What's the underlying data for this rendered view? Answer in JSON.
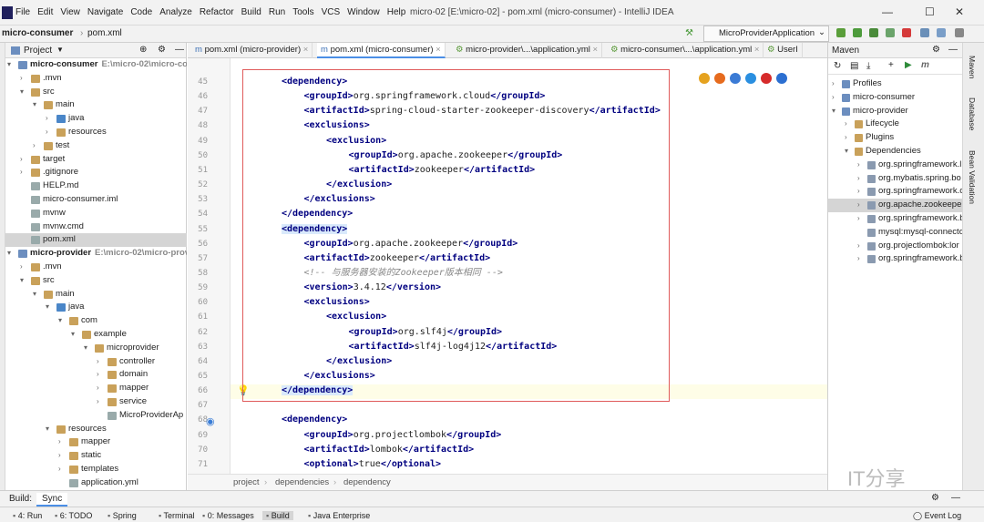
{
  "menu": [
    "File",
    "Edit",
    "View",
    "Navigate",
    "Code",
    "Analyze",
    "Refactor",
    "Build",
    "Run",
    "Tools",
    "VCS",
    "Window",
    "Help"
  ],
  "window_title": "micro-02 [E:\\micro-02] - pom.xml (micro-consumer) - IntelliJ IDEA",
  "breadcrumb_top": [
    "micro-consumer",
    "pom.xml"
  ],
  "run_config": "MicroProviderApplication",
  "project_panel": {
    "title": "Project"
  },
  "tree": [
    {
      "label": "micro-consumer",
      "path": "E:\\micro-02\\micro-cons",
      "level": 0,
      "bold": true
    },
    {
      "label": ".mvn",
      "level": 1
    },
    {
      "label": "src",
      "level": 1
    },
    {
      "label": "main",
      "level": 2
    },
    {
      "label": "java",
      "level": 3
    },
    {
      "label": "resources",
      "level": 3
    },
    {
      "label": "test",
      "level": 2
    },
    {
      "label": "target",
      "level": 1
    },
    {
      "label": ".gitignore",
      "level": 1
    },
    {
      "label": "HELP.md",
      "level": 1
    },
    {
      "label": "micro-consumer.iml",
      "level": 1
    },
    {
      "label": "mvnw",
      "level": 1
    },
    {
      "label": "mvnw.cmd",
      "level": 1
    },
    {
      "label": "pom.xml",
      "level": 1,
      "selected": true
    },
    {
      "label": "micro-provider",
      "path": "E:\\micro-02\\micro-provic",
      "level": 0,
      "bold": true
    },
    {
      "label": ".mvn",
      "level": 1
    },
    {
      "label": "src",
      "level": 1
    },
    {
      "label": "main",
      "level": 2
    },
    {
      "label": "java",
      "level": 3
    },
    {
      "label": "com",
      "level": 4
    },
    {
      "label": "example",
      "level": 5
    },
    {
      "label": "microprovider",
      "level": 6
    },
    {
      "label": "controller",
      "level": 7
    },
    {
      "label": "domain",
      "level": 7
    },
    {
      "label": "mapper",
      "level": 7
    },
    {
      "label": "service",
      "level": 7
    },
    {
      "label": "MicroProviderAp",
      "level": 7
    },
    {
      "label": "resources",
      "level": 3
    },
    {
      "label": "mapper",
      "level": 4
    },
    {
      "label": "static",
      "level": 4
    },
    {
      "label": "templates",
      "level": 4
    },
    {
      "label": "application.yml",
      "level": 4
    }
  ],
  "tabs": [
    {
      "label": "pom.xml (micro-provider)",
      "active": false
    },
    {
      "label": "pom.xml (micro-consumer)",
      "active": true
    },
    {
      "label": "micro-provider\\...\\application.yml",
      "active": false
    },
    {
      "label": "micro-consumer\\...\\application.yml",
      "active": false
    },
    {
      "label": "UserI",
      "active": false
    }
  ],
  "code_lines": [
    {
      "n": 45,
      "indent": 2,
      "parts": [
        [
          "t",
          "<dependency>"
        ]
      ]
    },
    {
      "n": 46,
      "indent": 3,
      "parts": [
        [
          "t",
          "<groupId>"
        ],
        [
          "x",
          "org.springframework.cloud"
        ],
        [
          "t",
          "</groupId>"
        ]
      ]
    },
    {
      "n": 47,
      "indent": 3,
      "parts": [
        [
          "t",
          "<artifactId>"
        ],
        [
          "x",
          "spring-cloud-starter-zookeeper-discovery"
        ],
        [
          "t",
          "</artifactId>"
        ]
      ]
    },
    {
      "n": 48,
      "indent": 3,
      "parts": [
        [
          "t",
          "<exclusions>"
        ]
      ]
    },
    {
      "n": 49,
      "indent": 4,
      "parts": [
        [
          "t",
          "<exclusion>"
        ]
      ]
    },
    {
      "n": 50,
      "indent": 5,
      "parts": [
        [
          "t",
          "<groupId>"
        ],
        [
          "x",
          "org.apache.zookeeper"
        ],
        [
          "t",
          "</groupId>"
        ]
      ]
    },
    {
      "n": 51,
      "indent": 5,
      "parts": [
        [
          "t",
          "<artifactId>"
        ],
        [
          "x",
          "zookeeper"
        ],
        [
          "t",
          "</artifactId>"
        ]
      ]
    },
    {
      "n": 52,
      "indent": 4,
      "parts": [
        [
          "t",
          "</exclusion>"
        ]
      ]
    },
    {
      "n": 53,
      "indent": 3,
      "parts": [
        [
          "t",
          "</exclusions>"
        ]
      ]
    },
    {
      "n": 54,
      "indent": 2,
      "parts": [
        [
          "t",
          "</dependency>"
        ]
      ]
    },
    {
      "n": 55,
      "indent": 2,
      "parts": [
        [
          "h",
          "<dependency>"
        ]
      ]
    },
    {
      "n": 56,
      "indent": 3,
      "parts": [
        [
          "t",
          "<groupId>"
        ],
        [
          "x",
          "org.apache.zookeeper"
        ],
        [
          "t",
          "</groupId>"
        ]
      ]
    },
    {
      "n": 57,
      "indent": 3,
      "parts": [
        [
          "t",
          "<artifactId>"
        ],
        [
          "x",
          "zookeeper"
        ],
        [
          "t",
          "</artifactId>"
        ]
      ]
    },
    {
      "n": 58,
      "indent": 3,
      "parts": [
        [
          "c",
          "<!-- 与服务器安装的Zookeeper版本相同 -->"
        ]
      ]
    },
    {
      "n": 59,
      "indent": 3,
      "parts": [
        [
          "t",
          "<version>"
        ],
        [
          "x",
          "3.4.12"
        ],
        [
          "t",
          "</version>"
        ]
      ]
    },
    {
      "n": 60,
      "indent": 3,
      "parts": [
        [
          "t",
          "<exclusions>"
        ]
      ]
    },
    {
      "n": 61,
      "indent": 4,
      "parts": [
        [
          "t",
          "<exclusion>"
        ]
      ]
    },
    {
      "n": 62,
      "indent": 5,
      "parts": [
        [
          "t",
          "<groupId>"
        ],
        [
          "x",
          "org.slf4j"
        ],
        [
          "t",
          "</groupId>"
        ]
      ]
    },
    {
      "n": 63,
      "indent": 5,
      "parts": [
        [
          "t",
          "<artifactId>"
        ],
        [
          "x",
          "slf4j-log4j12"
        ],
        [
          "t",
          "</artifactId>"
        ]
      ]
    },
    {
      "n": 64,
      "indent": 4,
      "parts": [
        [
          "t",
          "</exclusion>"
        ]
      ]
    },
    {
      "n": 65,
      "indent": 3,
      "parts": [
        [
          "t",
          "</exclusions>"
        ]
      ]
    },
    {
      "n": 66,
      "indent": 2,
      "parts": [
        [
          "h",
          "</dependency>"
        ]
      ]
    },
    {
      "n": 67,
      "indent": 0,
      "parts": []
    },
    {
      "n": 68,
      "indent": 2,
      "parts": [
        [
          "t",
          "<dependency>"
        ]
      ]
    },
    {
      "n": 69,
      "indent": 3,
      "parts": [
        [
          "t",
          "<groupId>"
        ],
        [
          "x",
          "org.projectlombok"
        ],
        [
          "t",
          "</groupId>"
        ]
      ]
    },
    {
      "n": 70,
      "indent": 3,
      "parts": [
        [
          "t",
          "<artifactId>"
        ],
        [
          "x",
          "lombok"
        ],
        [
          "t",
          "</artifactId>"
        ]
      ]
    },
    {
      "n": 71,
      "indent": 3,
      "parts": [
        [
          "t",
          "<optional>"
        ],
        [
          "x",
          "true"
        ],
        [
          "t",
          "</optional>"
        ]
      ]
    }
  ],
  "editor_breadcrumb": [
    "project",
    "dependencies",
    "dependency"
  ],
  "maven": {
    "title": "Maven",
    "items": [
      {
        "label": "Profiles",
        "level": 0
      },
      {
        "label": "micro-consumer",
        "level": 0
      },
      {
        "label": "micro-provider",
        "level": 0
      },
      {
        "label": "Lifecycle",
        "level": 1
      },
      {
        "label": "Plugins",
        "level": 1
      },
      {
        "label": "Dependencies",
        "level": 1
      },
      {
        "label": "org.springframework.l",
        "level": 2
      },
      {
        "label": "org.mybatis.spring.bo",
        "level": 2
      },
      {
        "label": "org.springframework.c",
        "level": 2
      },
      {
        "label": "org.apache.zookeepe",
        "level": 2,
        "selected": true
      },
      {
        "label": "org.springframework.b",
        "level": 2
      },
      {
        "label": "mysql:mysql-connecto",
        "level": 2
      },
      {
        "label": "org.projectlombok:lor",
        "level": 2
      },
      {
        "label": "org.springframework.b",
        "level": 2
      }
    ]
  },
  "right_strip": [
    "Maven",
    "Database",
    "Bean Validation"
  ],
  "build": {
    "label": "Build:",
    "tab": "Sync"
  },
  "bottom_tools": [
    "4: Run",
    "6: TODO",
    "Spring",
    "Terminal",
    "0: Messages",
    "Build",
    "Java Enterprise"
  ],
  "event_log": "Event Log",
  "watermark": "IT分享"
}
